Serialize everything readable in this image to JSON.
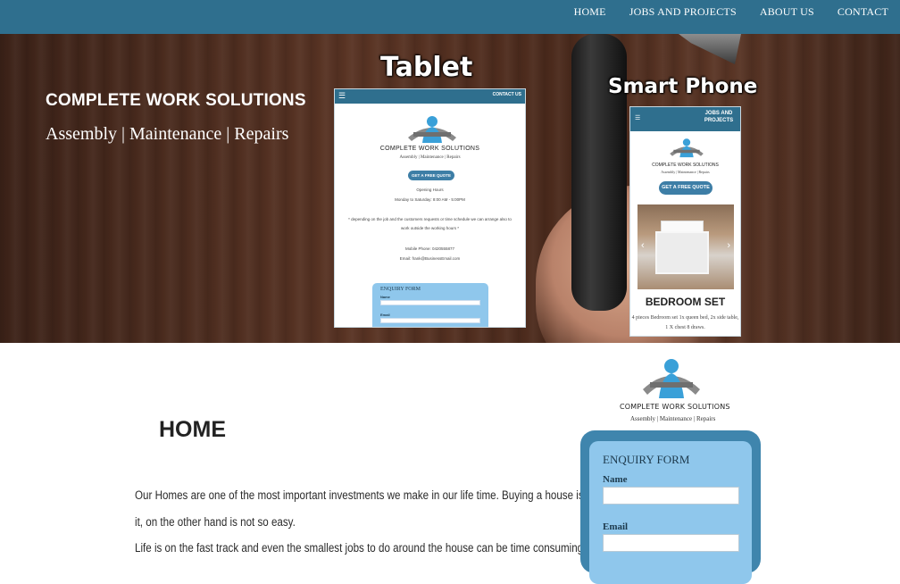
{
  "nav": {
    "items": [
      "HOME",
      "JOBS AND PROJECTS",
      "ABOUT US",
      "CONTACT"
    ]
  },
  "hero": {
    "title": "COMPLETE WORK SOLUTIONS",
    "subtitle": "Assembly | Maintenance | Repairs",
    "tablet_label": "Tablet",
    "phone_label": "Smart Phone"
  },
  "tablet": {
    "menu_icon": "hamburger-icon",
    "cta": "CONTACT US",
    "logo_name": "COMPLETE WORK SOLUTIONS",
    "logo_tagline": "Assembly | Maintenance | Repairs",
    "quote_button": "GET A FREE QUOTE",
    "opening_title": "Opening Hours",
    "opening_hours": "Monday to Saturday: 8:00 AM - 5:00PM",
    "note_line1": "* depending on the job and the customers requests or time schedule we can arrange also to",
    "note_line2": "work outside the working hours *",
    "phone": "Mobile Phone: 0420555877",
    "email": "Email: frank@BusinessEmail.com",
    "form_title": "ENQUIRY FORM",
    "form_name": "Name",
    "form_email": "Email"
  },
  "phone": {
    "menu_icon": "hamburger-icon",
    "cta": "JOBS AND PROJECTS",
    "logo_name": "COMPLETE WORK SOLUTIONS",
    "logo_tagline": "Assembly | Maintenance | Repairs",
    "quote_button": "GET A FREE QUOTE",
    "slide_title": "BEDROOM SET",
    "slide_desc_line1": "4 pieces Bedroom set 1x queen bed, 2x side table,",
    "slide_desc_line2": "1 X chest 8 draws."
  },
  "main": {
    "logo_name": "COMPLETE WORK SOLUTIONS",
    "logo_tagline": "Assembly | Maintenance | Repairs",
    "heading": "HOME",
    "para_line1": "Our Homes are one of the most important investments we make in our life time. Buying a house is fairly easy. Maintaining",
    "para_line2": "it, on the other hand is not so easy.",
    "para_line3": "Life is on the fast track and even the smallest jobs to do around the house can be time consuming."
  },
  "enquiry": {
    "title": "ENQUIRY FORM",
    "name_label": "Name",
    "email_label": "Email",
    "name_value": "",
    "email_value": ""
  },
  "colors": {
    "nav": "#2f6f8e",
    "button": "#3d7ea6",
    "form_outer": "#3f85ad",
    "form_inner": "#8fc7ec"
  }
}
